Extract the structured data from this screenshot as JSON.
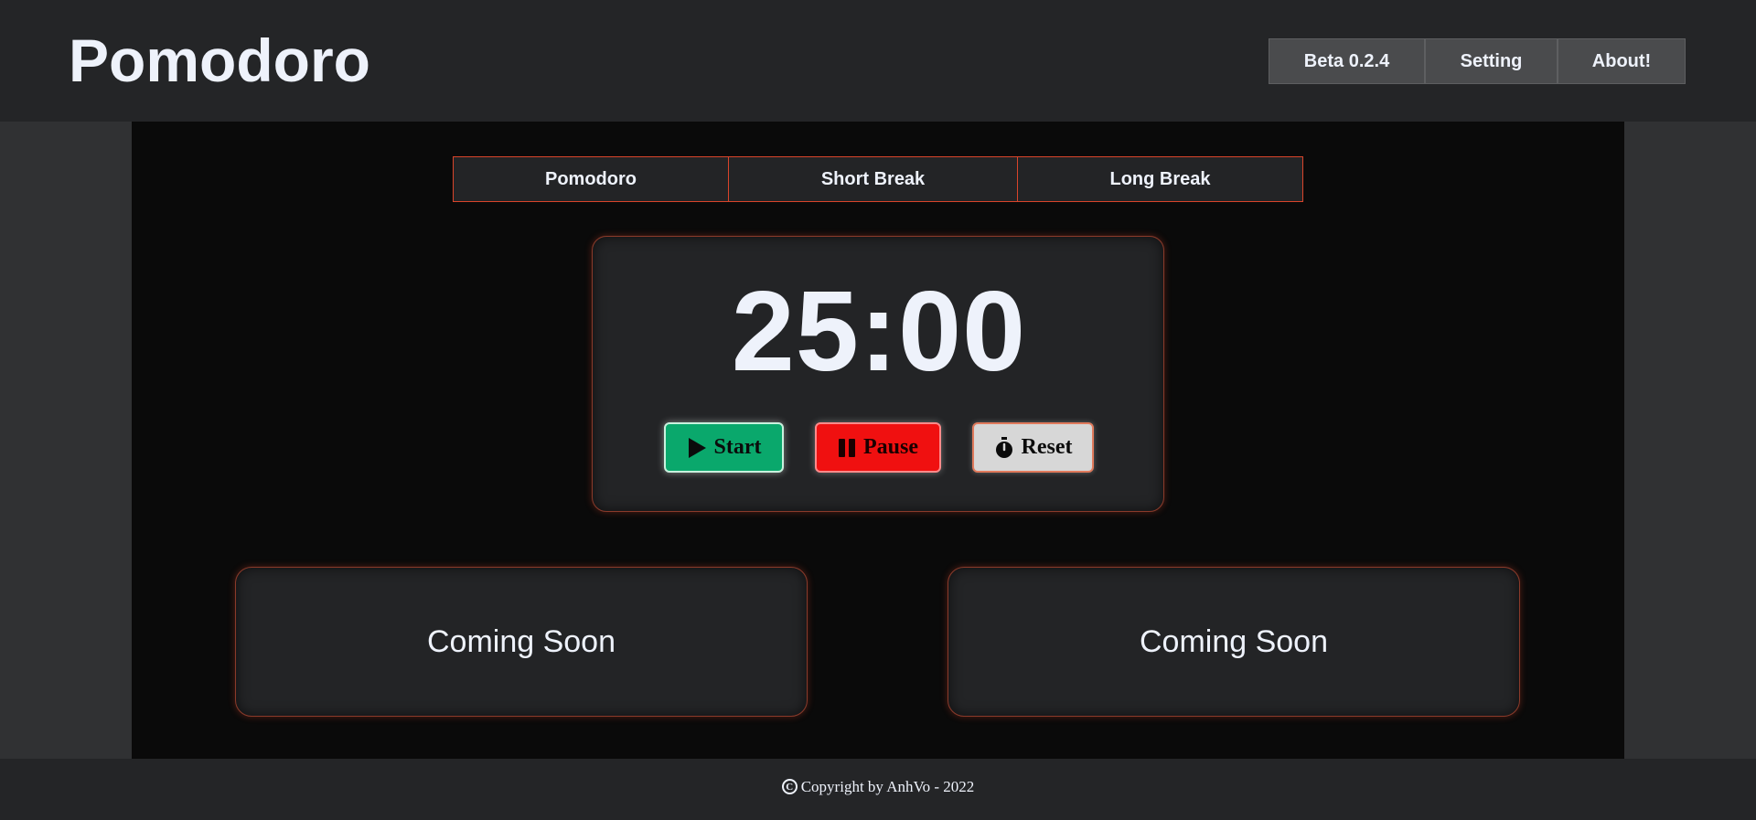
{
  "header": {
    "logo": "Pomodoro",
    "nav": [
      {
        "label": "Beta 0.2.4"
      },
      {
        "label": "Setting"
      },
      {
        "label": "About!"
      }
    ]
  },
  "tabs": [
    {
      "label": "Pomodoro"
    },
    {
      "label": "Short Break"
    },
    {
      "label": "Long Break"
    }
  ],
  "timer": {
    "time": "25:00",
    "start_label": "Start",
    "pause_label": "Pause",
    "reset_label": "Reset"
  },
  "cards": [
    {
      "label": "Coming Soon"
    },
    {
      "label": "Coming Soon"
    }
  ],
  "footer": {
    "copyright_symbol": "C",
    "text": "Copyright by AnhVo - 2022"
  },
  "colors": {
    "accent": "#d9442a",
    "start": "#0aa86c",
    "pause": "#f01010",
    "reset": "#d7d7d7"
  },
  "icons": {
    "start": "play-icon",
    "pause": "pause-icon",
    "reset": "stopwatch-icon"
  }
}
